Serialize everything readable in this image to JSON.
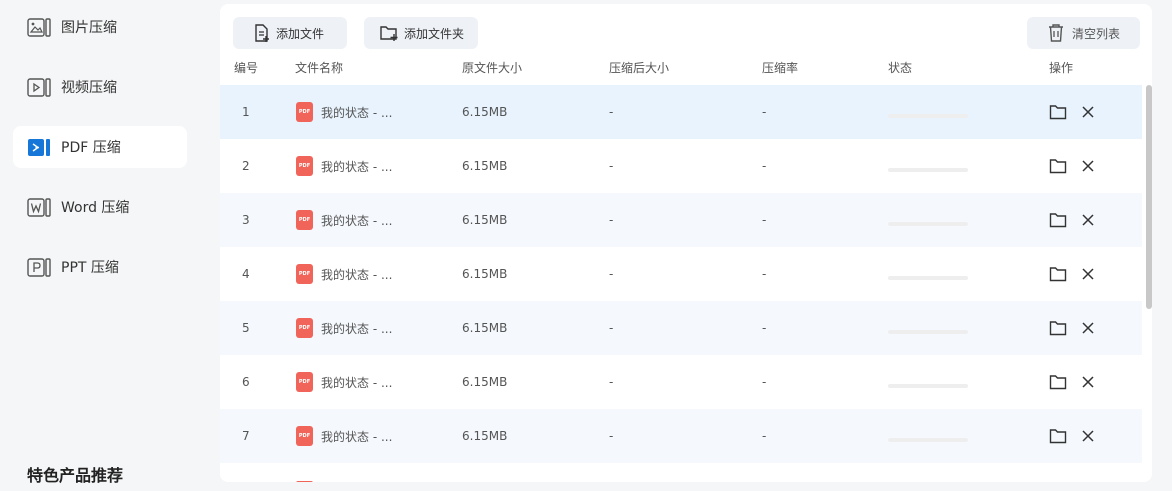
{
  "sidebar": {
    "items": [
      {
        "label": "图片压缩",
        "icon": "image-icon",
        "active": false
      },
      {
        "label": "视频压缩",
        "icon": "video-icon",
        "active": false
      },
      {
        "label": "PDF 压缩",
        "icon": "pdf-icon",
        "active": true
      },
      {
        "label": "Word 压缩",
        "icon": "word-icon",
        "active": false
      },
      {
        "label": "PPT 压缩",
        "icon": "ppt-icon",
        "active": false
      }
    ],
    "featured_heading": "特色产品推荐"
  },
  "toolbar": {
    "add_file_label": "添加文件",
    "add_folder_label": "添加文件夹",
    "clear_list_label": "清空列表"
  },
  "table": {
    "columns": [
      "编号",
      "文件名称",
      "原文件大小",
      "压缩后大小",
      "压缩率",
      "状态",
      "操作"
    ],
    "rows": [
      {
        "index": "1",
        "name": "我的状态 - ...",
        "badge": "PDF",
        "original_size": "6.15MB",
        "compressed_size": "-",
        "ratio": "-",
        "progress": 0
      },
      {
        "index": "2",
        "name": "我的状态 - ...",
        "badge": "PDF",
        "original_size": "6.15MB",
        "compressed_size": "-",
        "ratio": "-",
        "progress": 0
      },
      {
        "index": "3",
        "name": "我的状态 - ...",
        "badge": "PDF",
        "original_size": "6.15MB",
        "compressed_size": "-",
        "ratio": "-",
        "progress": 0
      },
      {
        "index": "4",
        "name": "我的状态 - ...",
        "badge": "PDF",
        "original_size": "6.15MB",
        "compressed_size": "-",
        "ratio": "-",
        "progress": 0
      },
      {
        "index": "5",
        "name": "我的状态 - ...",
        "badge": "PDF",
        "original_size": "6.15MB",
        "compressed_size": "-",
        "ratio": "-",
        "progress": 0
      },
      {
        "index": "6",
        "name": "我的状态 - ...",
        "badge": "PDF",
        "original_size": "6.15MB",
        "compressed_size": "-",
        "ratio": "-",
        "progress": 0
      },
      {
        "index": "7",
        "name": "我的状态 - ...",
        "badge": "PDF",
        "original_size": "6.15MB",
        "compressed_size": "-",
        "ratio": "-",
        "progress": 0
      }
    ]
  },
  "colors": {
    "accent": "#1677d9",
    "pdf_badge": "#f0645a",
    "selected_row": "#e8f3fd",
    "striped_row": "#f5f9fd"
  }
}
